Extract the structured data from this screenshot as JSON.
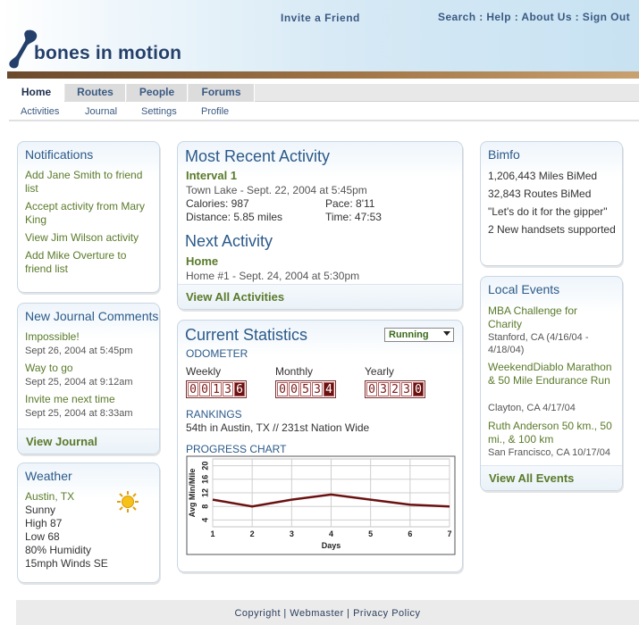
{
  "header": {
    "invite": "Invite a Friend",
    "links": [
      "Search",
      "Help",
      "About Us",
      "Sign Out"
    ],
    "logo_text": "bones in motion"
  },
  "tabs": [
    "Home",
    "Routes",
    "People",
    "Forums"
  ],
  "subnav": [
    "Activities",
    "Journal",
    "Settings",
    "Profile"
  ],
  "notifications": {
    "title": "Notifications",
    "items": [
      "Add Jane Smith to friend list",
      "Accept activity from Mary King",
      "View Jim Wilson activity",
      "Add Mike Overture to friend list"
    ]
  },
  "journal": {
    "title": "New Journal Comments",
    "items": [
      {
        "title": "Impossible!",
        "date": "Sept 26, 2004 at 5:45pm"
      },
      {
        "title": "Way to go",
        "date": "Sept 25, 2004 at 9:12am"
      },
      {
        "title": "Invite me next time",
        "date": "Sept 25, 2004 at 8:33am"
      }
    ],
    "footer": "View Journal"
  },
  "weather": {
    "title": "Weather",
    "location": "Austin, TX",
    "lines": [
      "Sunny",
      "High 87",
      "Low 68",
      "80% Humidity",
      "15mph Winds SE"
    ],
    "icon": "sun-icon"
  },
  "recent": {
    "title": "Most Recent Activity",
    "activity": "Interval 1",
    "where": "Town Lake - Sept. 22, 2004 at 5:45pm",
    "calories": "Calories: 987",
    "pace": "Pace: 8'11",
    "distance": "Distance: 5.85 miles",
    "time": "Time: 47:53",
    "next_title": "Next Activity",
    "next_activity": "Home",
    "next_where": "Home #1 - Sept. 24, 2004 at 5:30pm",
    "footer": "View All Activities"
  },
  "stats": {
    "title": "Current Statistics",
    "dropdown": "Running",
    "odometer_label": "ODOMETER",
    "weekly_label": "Weekly",
    "weekly_digits": [
      "0",
      "0",
      "1",
      "3",
      "6"
    ],
    "monthly_label": "Monthly",
    "monthly_digits": [
      "0",
      "0",
      "5",
      "3",
      "4"
    ],
    "yearly_label": "Yearly",
    "yearly_digits": [
      "0",
      "3",
      "2",
      "3",
      "0"
    ],
    "rankings_label": "RANKINGS",
    "rankings_text": "54th in Austin, TX // 231st Nation Wide",
    "chart_label": "PROGRESS CHART"
  },
  "chart_data": {
    "type": "line",
    "x": [
      1,
      2,
      3,
      4,
      5,
      6,
      7
    ],
    "y": [
      10,
      8,
      10,
      11.5,
      10,
      8.5,
      8
    ],
    "xlabel": "Days",
    "ylabel": "Avg Min/Mile",
    "xticks": [
      "1",
      "2",
      "3",
      "4",
      "5",
      "6",
      "7"
    ],
    "yticks": [
      "4",
      "8",
      "12",
      "16",
      "20"
    ],
    "ylim": [
      2,
      22
    ],
    "grid": true,
    "color": "#6b1111"
  },
  "bimfo": {
    "title": "Bimfo",
    "lines": [
      "1,206,443 Miles BiMed",
      "32,843 Routes BiMed",
      "\"Let's do it for the gipper\"",
      "2 New handsets supported"
    ]
  },
  "events": {
    "title": "Local Events",
    "items": [
      {
        "name": "MBA Challenge for Charity",
        "meta": "Stanford, CA (4/16/04 - 4/18/04)"
      },
      {
        "name": "WeekendDiablo Marathon & 50 Mile Endurance Run",
        "meta": "Clayton, CA 4/17/04"
      },
      {
        "name": "Ruth Anderson 50 km., 50 mi., & 100 km",
        "meta": "San Francisco, CA 10/17/04"
      }
    ],
    "footer": "View All Events"
  },
  "footer": {
    "copyright": "Copyright",
    "webmaster": "Webmaster",
    "privacy": "Privacy Policy"
  }
}
